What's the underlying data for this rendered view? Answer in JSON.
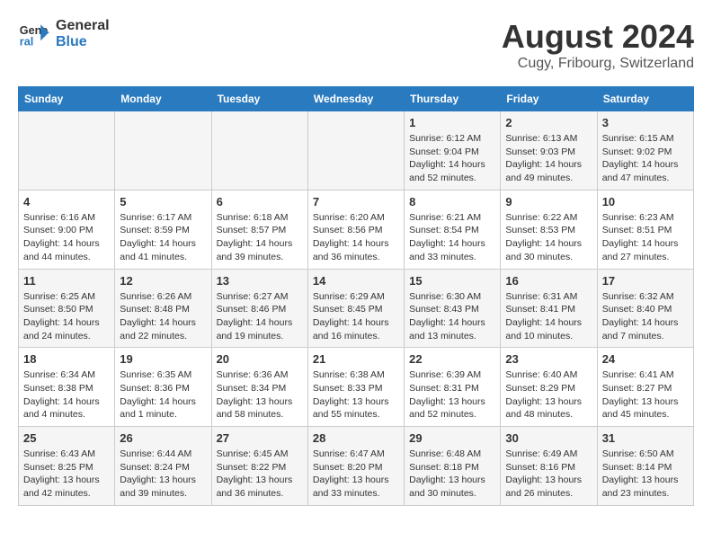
{
  "logo": {
    "line1": "General",
    "line2": "Blue"
  },
  "title": "August 2024",
  "subtitle": "Cugy, Fribourg, Switzerland",
  "days_of_week": [
    "Sunday",
    "Monday",
    "Tuesday",
    "Wednesday",
    "Thursday",
    "Friday",
    "Saturday"
  ],
  "weeks": [
    [
      {
        "day": "",
        "info": ""
      },
      {
        "day": "",
        "info": ""
      },
      {
        "day": "",
        "info": ""
      },
      {
        "day": "",
        "info": ""
      },
      {
        "day": "1",
        "info": "Sunrise: 6:12 AM\nSunset: 9:04 PM\nDaylight: 14 hours and 52 minutes."
      },
      {
        "day": "2",
        "info": "Sunrise: 6:13 AM\nSunset: 9:03 PM\nDaylight: 14 hours and 49 minutes."
      },
      {
        "day": "3",
        "info": "Sunrise: 6:15 AM\nSunset: 9:02 PM\nDaylight: 14 hours and 47 minutes."
      }
    ],
    [
      {
        "day": "4",
        "info": "Sunrise: 6:16 AM\nSunset: 9:00 PM\nDaylight: 14 hours and 44 minutes."
      },
      {
        "day": "5",
        "info": "Sunrise: 6:17 AM\nSunset: 8:59 PM\nDaylight: 14 hours and 41 minutes."
      },
      {
        "day": "6",
        "info": "Sunrise: 6:18 AM\nSunset: 8:57 PM\nDaylight: 14 hours and 39 minutes."
      },
      {
        "day": "7",
        "info": "Sunrise: 6:20 AM\nSunset: 8:56 PM\nDaylight: 14 hours and 36 minutes."
      },
      {
        "day": "8",
        "info": "Sunrise: 6:21 AM\nSunset: 8:54 PM\nDaylight: 14 hours and 33 minutes."
      },
      {
        "day": "9",
        "info": "Sunrise: 6:22 AM\nSunset: 8:53 PM\nDaylight: 14 hours and 30 minutes."
      },
      {
        "day": "10",
        "info": "Sunrise: 6:23 AM\nSunset: 8:51 PM\nDaylight: 14 hours and 27 minutes."
      }
    ],
    [
      {
        "day": "11",
        "info": "Sunrise: 6:25 AM\nSunset: 8:50 PM\nDaylight: 14 hours and 24 minutes."
      },
      {
        "day": "12",
        "info": "Sunrise: 6:26 AM\nSunset: 8:48 PM\nDaylight: 14 hours and 22 minutes."
      },
      {
        "day": "13",
        "info": "Sunrise: 6:27 AM\nSunset: 8:46 PM\nDaylight: 14 hours and 19 minutes."
      },
      {
        "day": "14",
        "info": "Sunrise: 6:29 AM\nSunset: 8:45 PM\nDaylight: 14 hours and 16 minutes."
      },
      {
        "day": "15",
        "info": "Sunrise: 6:30 AM\nSunset: 8:43 PM\nDaylight: 14 hours and 13 minutes."
      },
      {
        "day": "16",
        "info": "Sunrise: 6:31 AM\nSunset: 8:41 PM\nDaylight: 14 hours and 10 minutes."
      },
      {
        "day": "17",
        "info": "Sunrise: 6:32 AM\nSunset: 8:40 PM\nDaylight: 14 hours and 7 minutes."
      }
    ],
    [
      {
        "day": "18",
        "info": "Sunrise: 6:34 AM\nSunset: 8:38 PM\nDaylight: 14 hours and 4 minutes."
      },
      {
        "day": "19",
        "info": "Sunrise: 6:35 AM\nSunset: 8:36 PM\nDaylight: 14 hours and 1 minute."
      },
      {
        "day": "20",
        "info": "Sunrise: 6:36 AM\nSunset: 8:34 PM\nDaylight: 13 hours and 58 minutes."
      },
      {
        "day": "21",
        "info": "Sunrise: 6:38 AM\nSunset: 8:33 PM\nDaylight: 13 hours and 55 minutes."
      },
      {
        "day": "22",
        "info": "Sunrise: 6:39 AM\nSunset: 8:31 PM\nDaylight: 13 hours and 52 minutes."
      },
      {
        "day": "23",
        "info": "Sunrise: 6:40 AM\nSunset: 8:29 PM\nDaylight: 13 hours and 48 minutes."
      },
      {
        "day": "24",
        "info": "Sunrise: 6:41 AM\nSunset: 8:27 PM\nDaylight: 13 hours and 45 minutes."
      }
    ],
    [
      {
        "day": "25",
        "info": "Sunrise: 6:43 AM\nSunset: 8:25 PM\nDaylight: 13 hours and 42 minutes."
      },
      {
        "day": "26",
        "info": "Sunrise: 6:44 AM\nSunset: 8:24 PM\nDaylight: 13 hours and 39 minutes."
      },
      {
        "day": "27",
        "info": "Sunrise: 6:45 AM\nSunset: 8:22 PM\nDaylight: 13 hours and 36 minutes."
      },
      {
        "day": "28",
        "info": "Sunrise: 6:47 AM\nSunset: 8:20 PM\nDaylight: 13 hours and 33 minutes."
      },
      {
        "day": "29",
        "info": "Sunrise: 6:48 AM\nSunset: 8:18 PM\nDaylight: 13 hours and 30 minutes."
      },
      {
        "day": "30",
        "info": "Sunrise: 6:49 AM\nSunset: 8:16 PM\nDaylight: 13 hours and 26 minutes."
      },
      {
        "day": "31",
        "info": "Sunrise: 6:50 AM\nSunset: 8:14 PM\nDaylight: 13 hours and 23 minutes."
      }
    ]
  ]
}
